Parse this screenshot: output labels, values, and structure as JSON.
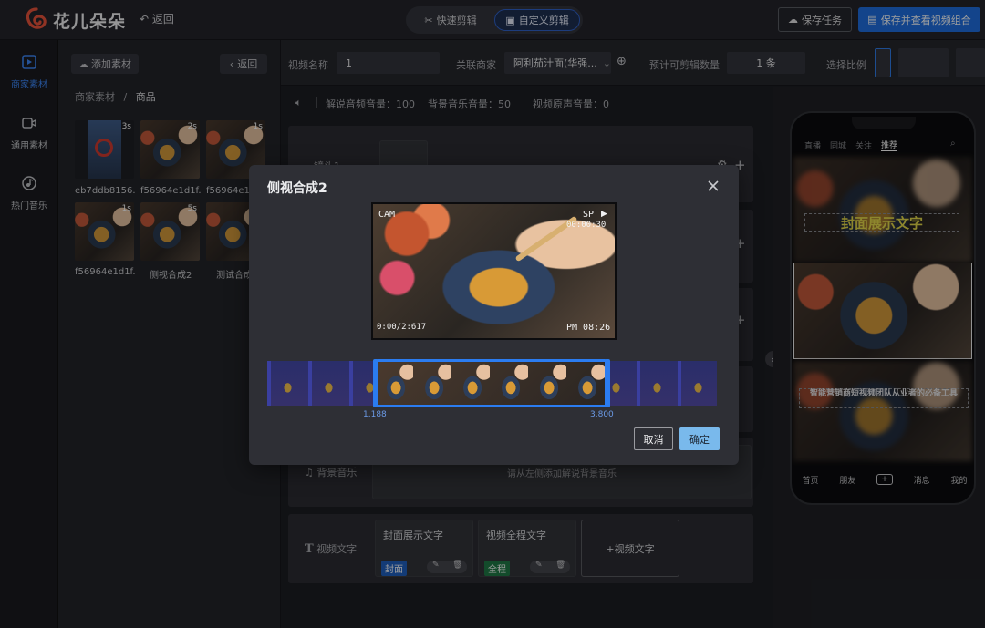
{
  "header": {
    "brand": "花儿朵朵",
    "back_label": "返回",
    "mode_tabs": [
      "快速剪辑",
      "自定义剪辑"
    ],
    "active_mode": "自定义剪辑",
    "save_task_label": "保存任务",
    "save_view_label": "保存并查看视频组合"
  },
  "sidebar": {
    "items": [
      {
        "label": "商家素材",
        "icon": "video-icon",
        "active": true
      },
      {
        "label": "通用素材",
        "icon": "camera-icon",
        "active": false
      },
      {
        "label": "热门音乐",
        "icon": "music-icon",
        "active": false
      }
    ]
  },
  "materials": {
    "add_label": "添加素材",
    "back_label": "返回",
    "breadcrumb": [
      "商家素材",
      "/",
      "商品"
    ],
    "items": [
      {
        "label": "eb7ddb8156...",
        "duration": "3s"
      },
      {
        "label": "f56964e1d1f...",
        "duration": "2s"
      },
      {
        "label": "f56964e1d...",
        "duration": "1s"
      },
      {
        "label": "f56964e1d1f...",
        "duration": "1s"
      },
      {
        "label": "侧视合成2",
        "duration": "5s"
      },
      {
        "label": "测试合成",
        "duration": ""
      }
    ]
  },
  "settings": {
    "video_name_label": "视频名称",
    "video_name_value": "1",
    "merchant_label": "关联商家",
    "merchant_value": "阿利茄汁面(华强...",
    "estimate_label": "预计可剪辑数量",
    "estimate_value": "1 条",
    "ratio_label": "选择比例"
  },
  "audio": {
    "narration": "解说音频音量：100",
    "bgm": "背景音乐音量：50",
    "original": "视频原声音量：0"
  },
  "editor": {
    "shot_label": "镜头1",
    "bgm_label": "背景音乐",
    "bgm_hint": "请从左侧添加解说背景音乐",
    "text_label": "视频文字",
    "text_cards": [
      {
        "title": "封面展示文字",
        "tag": "封面",
        "tag_color": "#1f5fbf"
      },
      {
        "title": "视频全程文字",
        "tag": "全程",
        "tag_color": "#1f7a46"
      }
    ],
    "add_text_label": "+视频文字"
  },
  "phone": {
    "top_tabs": [
      "直播",
      "同城",
      "关注",
      "推荐"
    ],
    "cover_text": "封面展示文字",
    "caption": "智能营销商短视频团队从业者的必备工具",
    "bottom_tabs": [
      "首页",
      "朋友",
      "+",
      "消息",
      "我的"
    ]
  },
  "modal": {
    "title": "侧视合成2",
    "cam_label": "CAM",
    "sp_label": "SP",
    "time_top": "00:00:30",
    "date_text": "0:00/2:617",
    "time_bottom": "PM 08:26",
    "range_start": "1.188",
    "range_end": "3.800",
    "range_fraction": [
      0.241,
      0.771
    ],
    "cancel_label": "取消",
    "ok_label": "确定"
  },
  "colors": {
    "accent": "#1f6fe0",
    "ok": "#79b9ec",
    "selection": "#2b7cf0"
  }
}
